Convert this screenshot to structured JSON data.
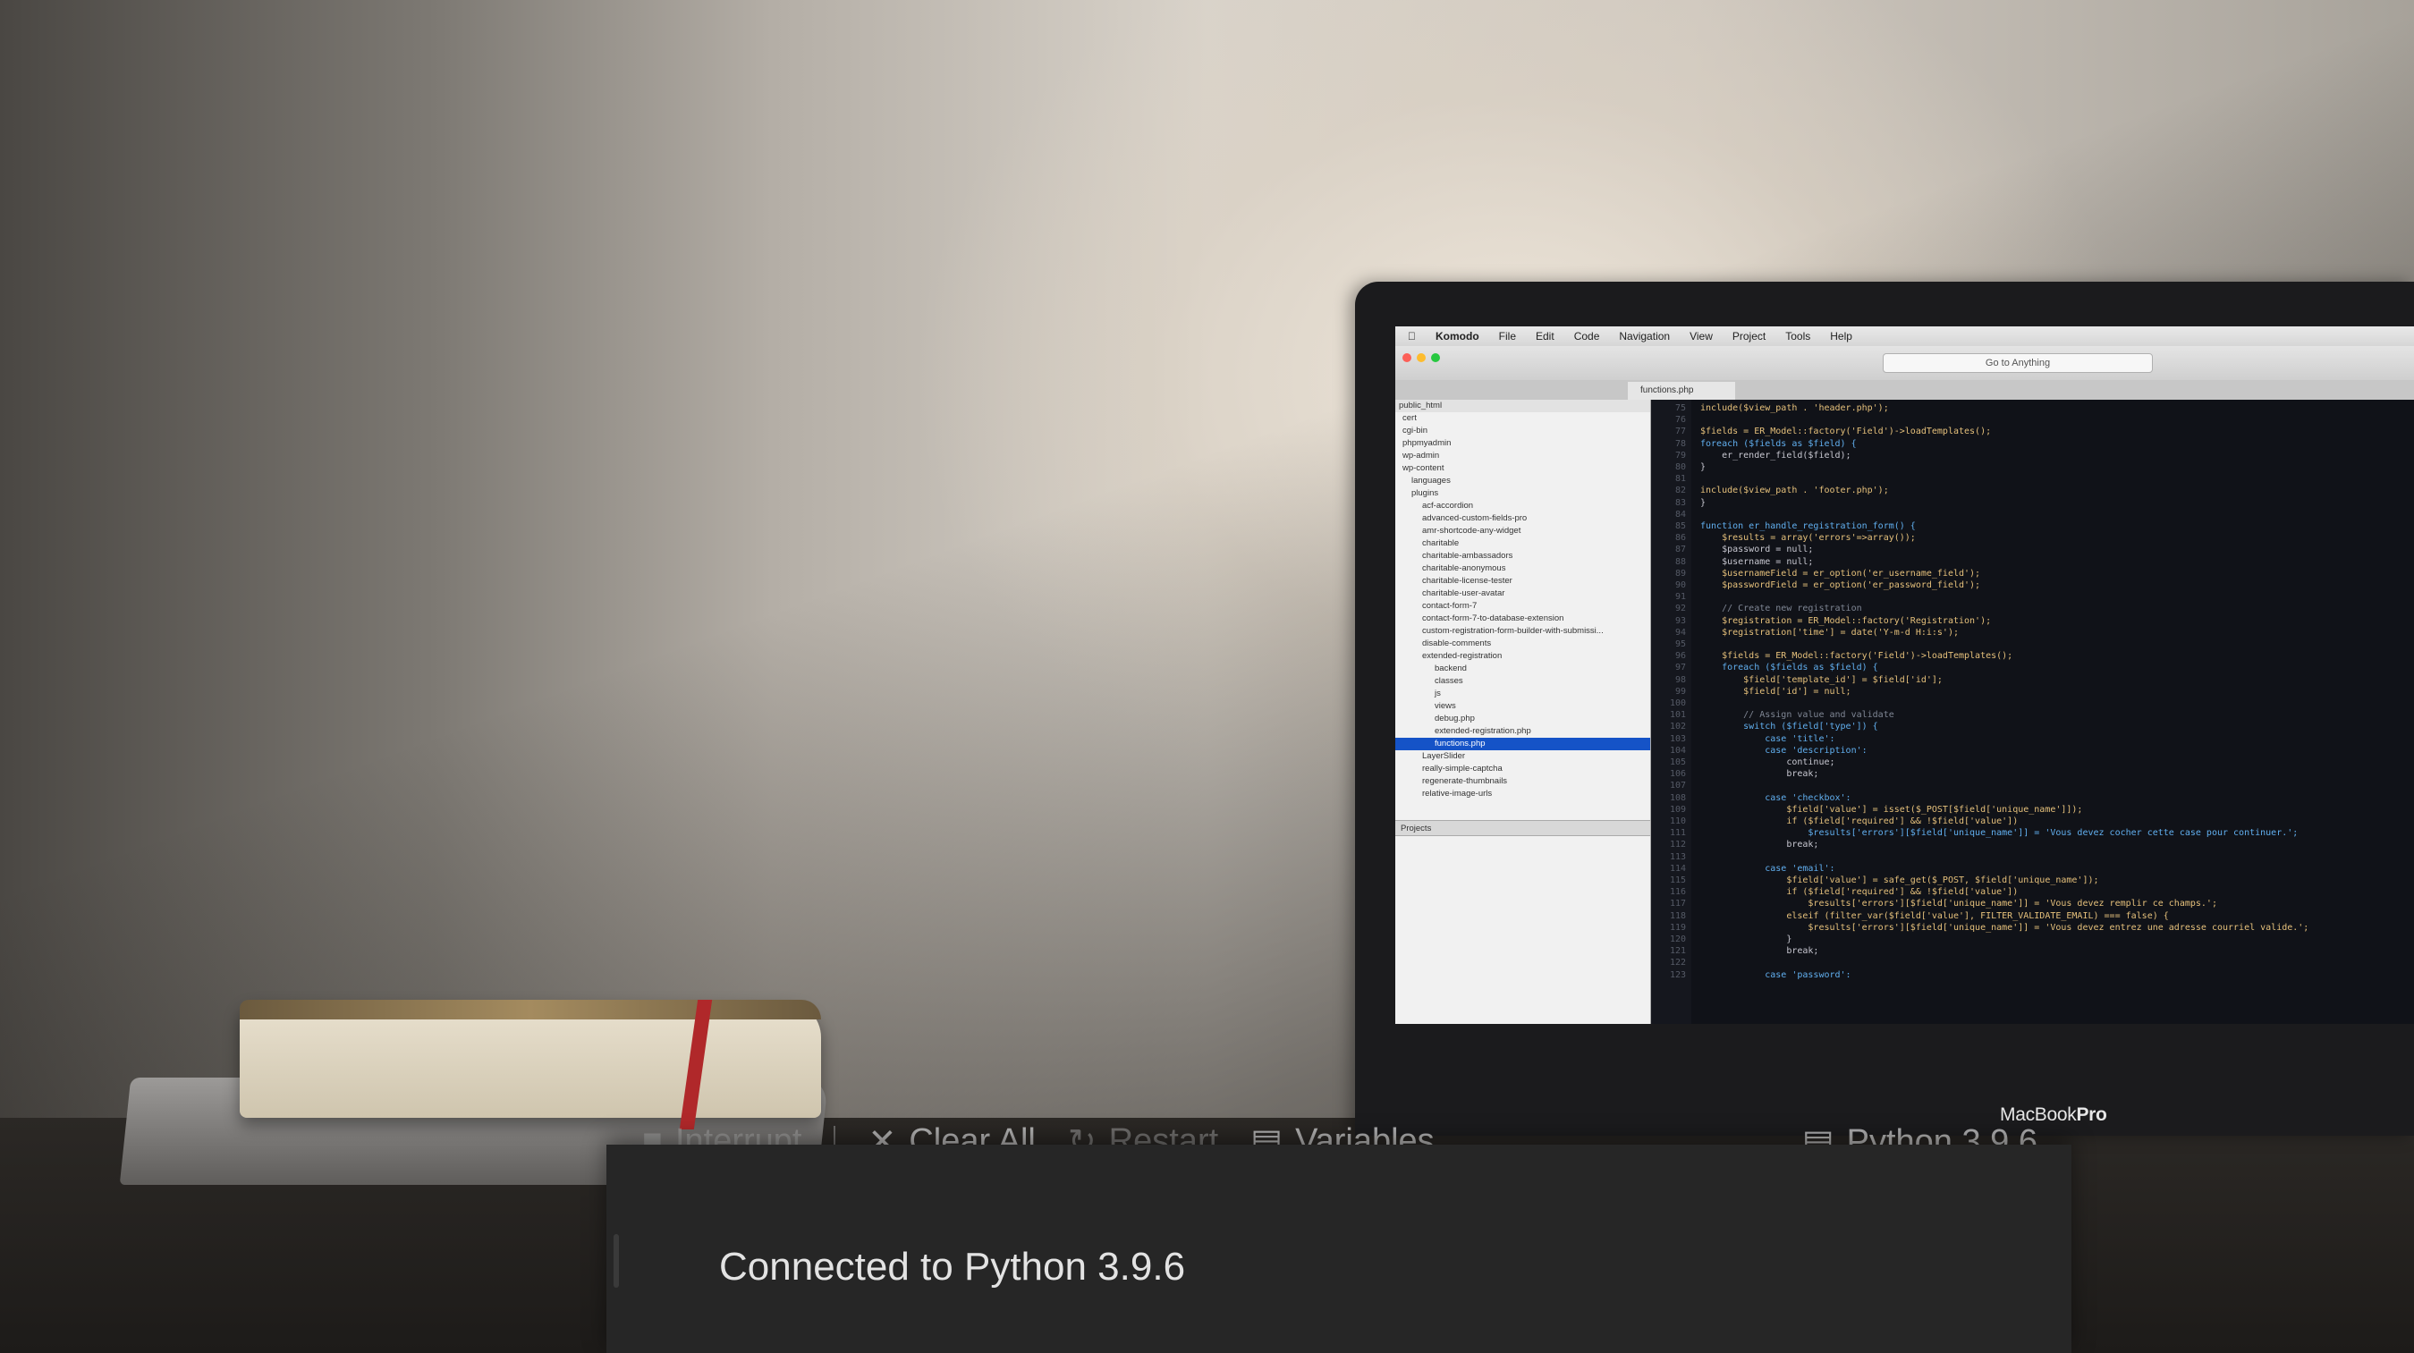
{
  "laptop": {
    "brand": "MacBook",
    "model": "Pro",
    "menubar": {
      "app_name": "Komodo",
      "menus": [
        "File",
        "Edit",
        "Code",
        "Navigation",
        "View",
        "Project",
        "Tools",
        "Help"
      ]
    },
    "goto_placeholder": "Go to Anything",
    "open_tab": "functions.php",
    "sidebar": {
      "root": "public_html",
      "items": [
        "cert",
        "cgi-bin",
        "phpmyadmin",
        "wp-admin",
        "wp-content",
        "languages",
        "plugins",
        "acf-accordion",
        "advanced-custom-fields-pro",
        "amr-shortcode-any-widget",
        "charitable",
        "charitable-ambassadors",
        "charitable-anonymous",
        "charitable-license-tester",
        "charitable-user-avatar",
        "contact-form-7",
        "contact-form-7-to-database-extension",
        "custom-registration-form-builder-with-submissi...",
        "disable-comments",
        "extended-registration",
        "backend",
        "classes",
        "js",
        "views",
        "debug.php",
        "extended-registration.php",
        "functions.php",
        "LayerSlider",
        "really-simple-captcha",
        "regenerate-thumbnails",
        "relative-image-urls"
      ],
      "selected": "functions.php",
      "projects_label": "Projects"
    },
    "code": [
      "include($view_path . 'header.php');",
      "",
      "$fields = ER_Model::factory('Field')->loadTemplates();",
      "foreach ($fields as $field) {",
      "    er_render_field($field);",
      "}",
      "",
      "include($view_path . 'footer.php');",
      "}",
      "",
      "function er_handle_registration_form() {",
      "    $results = array('errors'=>array());",
      "    $password = null;",
      "    $username = null;",
      "    $usernameField = er_option('er_username_field');",
      "    $passwordField = er_option('er_password_field');",
      "",
      "    // Create new registration",
      "    $registration = ER_Model::factory('Registration');",
      "    $registration['time'] = date('Y-m-d H:i:s');",
      "",
      "    $fields = ER_Model::factory('Field')->loadTemplates();",
      "    foreach ($fields as $field) {",
      "        $field['template_id'] = $field['id'];",
      "        $field['id'] = null;",
      "",
      "        // Assign value and validate",
      "        switch ($field['type']) {",
      "            case 'title':",
      "            case 'description':",
      "                continue;",
      "                break;",
      "",
      "            case 'checkbox':",
      "                $field['value'] = isset($_POST[$field['unique_name']]);",
      "                if ($field['required'] && !$field['value'])",
      "                    $results['errors'][$field['unique_name']] = 'Vous devez cocher cette case pour continuer.';",
      "                break;",
      "",
      "            case 'email':",
      "                $field['value'] = safe_get($_POST, $field['unique_name']);",
      "                if ($field['required'] && !$field['value'])",
      "                    $results['errors'][$field['unique_name']] = 'Vous devez remplir ce champs.';",
      "                elseif (filter_var($field['value'], FILTER_VALIDATE_EMAIL) === false) {",
      "                    $results['errors'][$field['unique_name']] = 'Vous devez entrez une adresse courriel valide.';",
      "                }",
      "                break;",
      "",
      "            case 'password':"
    ],
    "line_numbers_start": 75
  },
  "kernel_toolbar": {
    "interrupt": "Interrupt",
    "clear_all": "Clear All",
    "restart": "Restart",
    "variables": "Variables",
    "kernel_name": "Python 3.9.6"
  },
  "notification": {
    "message": "Connected to Python 3.9.6"
  },
  "colors": {
    "toast_bg": "#262626",
    "selection": "#1553c7",
    "editor_bg": "#101218"
  }
}
